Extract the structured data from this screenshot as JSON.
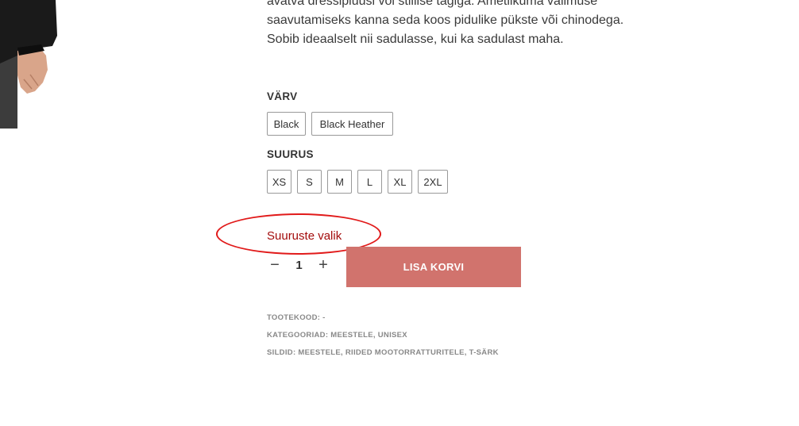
{
  "description": {
    "lines": [
      "avatva dressipluusi või stiilise tagiga. Ametlikuma välimuse",
      "saavutamiseks kanna seda koos pidulike pükste või chinodega.",
      "Sobib ideaalselt nii sadulasse, kui ka sadulast maha."
    ]
  },
  "color": {
    "label": "VÄRV",
    "options": [
      "Black",
      "Black Heather"
    ]
  },
  "size": {
    "label": "SUURUS",
    "options": [
      "XS",
      "S",
      "M",
      "L",
      "XL",
      "2XL"
    ]
  },
  "size_guide": "Suuruste valik",
  "quantity": {
    "minus": "−",
    "value": "1",
    "plus": "+"
  },
  "add_to_cart": "LISA KORVI",
  "meta": {
    "sku_label": "TOOTEKOOD:",
    "sku_value": "-",
    "categories_label": "KATEGOORIAD:",
    "categories": [
      "MEESTELE",
      "UNISEX"
    ],
    "tags_label": "SILDID:",
    "tags": [
      "MEESTELE",
      "RIIDED MOOTORRATTURITELE",
      "T-SÄRK"
    ]
  },
  "colors": {
    "add_to_cart_bg": "#d1736d",
    "size_guide_text": "#a30c0c",
    "annotation": "#e11a1a"
  }
}
